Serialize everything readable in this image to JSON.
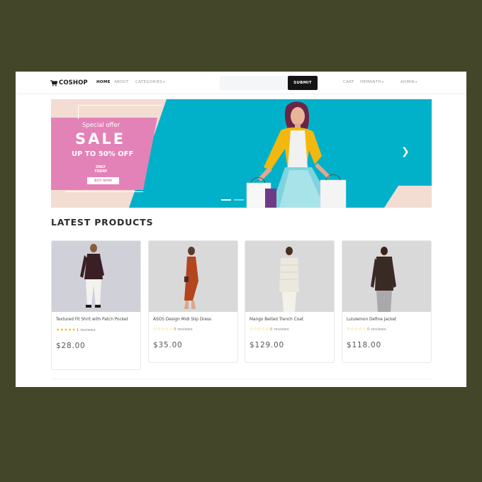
{
  "navbar": {
    "brand": "COSHOP",
    "links": [
      "HOME",
      "ABOUT",
      "CATEGORIES"
    ],
    "search": {
      "placeholder": "",
      "value": ""
    },
    "submit_label": "SUBMIT",
    "right_links": [
      "CART",
      "HEMANTH",
      "ADMIN"
    ]
  },
  "hero": {
    "special_offer": "Special offer",
    "sale": "SALE",
    "discount": "UP TO 50% OFF",
    "only_line1": "ONLY",
    "only_line2": "TODAY",
    "buy_now": "BUY NOW",
    "next_icon": "chevron-right-icon"
  },
  "products_section": {
    "title": "LATEST PRODUCTS",
    "products": [
      {
        "name": "Textured Fit Shirt with Patch Pocket",
        "stars": "★★★★★",
        "reviews": "1 reviews",
        "price": "$28.00"
      },
      {
        "name": "ASOS Design Midi Slip Dress",
        "stars": "☆☆☆☆☆",
        "reviews": "0 reviews",
        "price": "$35.00"
      },
      {
        "name": "Mango Belted Trench Coat",
        "stars": "☆☆☆☆☆",
        "reviews": "0 reviews",
        "price": "$129.00"
      },
      {
        "name": "Lululemon Define Jacket",
        "stars": "☆☆☆☆☆",
        "reviews": "0 reviews",
        "price": "$118.00"
      }
    ]
  },
  "colors": {
    "background": "#434628",
    "hero_teal": "#00b1c9",
    "hero_pink": "#e382b6",
    "hero_peach": "#f3dcd2",
    "star": "#f2c200"
  }
}
